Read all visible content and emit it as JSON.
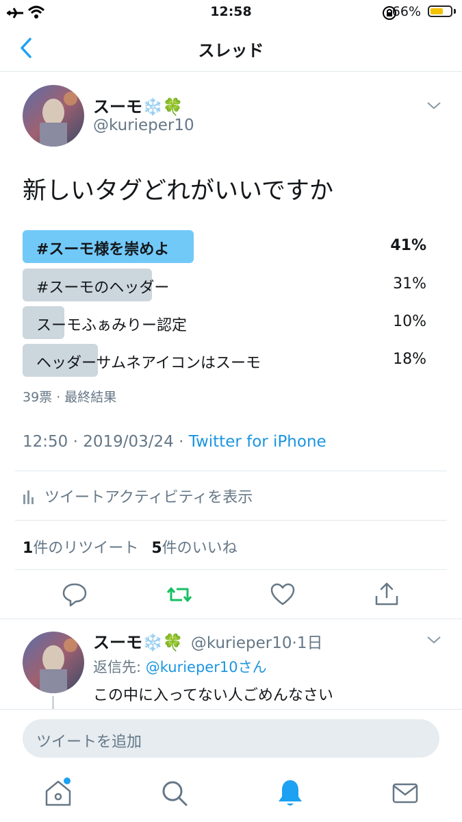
{
  "status": {
    "time": "12:58",
    "battery_pct": "66%",
    "battery_level": 0.66
  },
  "nav": {
    "title": "スレッド"
  },
  "tweet": {
    "name": "スーモ❄️🍀",
    "handle": "@kurieper10",
    "text": "新しいタグどれがいいですか",
    "poll": {
      "options": [
        {
          "label": "#スーモ様を崇めよ",
          "pct": "41%",
          "value": 0.41
        },
        {
          "label": "#スーモのヘッダー",
          "pct": "31%",
          "value": 0.31
        },
        {
          "label": "スーモふぁみりー認定",
          "pct": "10%",
          "value": 0.1
        },
        {
          "label": "ヘッダーサムネアイコンはスーモ",
          "pct": "18%",
          "value": 0.18
        }
      ],
      "meta": "39票 · 最終結果"
    },
    "timestamp": "12:50 · 2019/03/24 · ",
    "source": "Twitter for iPhone",
    "activity": "ツイートアクティビティを表示",
    "retweet_count": "1",
    "retweet_label": "件のリツイート",
    "like_count": "5",
    "like_label": "件のいいね"
  },
  "reply": {
    "name": "スーモ❄️🍀",
    "handle_time": "@kurieper10·1日",
    "reply_prefix": "返信先: ",
    "reply_to": "@kurieper10さん",
    "text": "この中に入ってない人ごめんなさい"
  },
  "compose": {
    "placeholder": "ツイートを追加"
  },
  "colors": {
    "accent": "#1da1f2",
    "retweet_active": "#17bf63",
    "poll_winner": "#71c9f8",
    "poll_bar": "#ccd6dd"
  },
  "icons": [
    "airplane-icon",
    "wifi-icon",
    "lock-rotation-icon",
    "back-chevron-icon",
    "chevron-down-icon",
    "stats-icon",
    "reply-icon",
    "retweet-icon",
    "like-icon",
    "share-icon",
    "home-icon",
    "search-icon",
    "notifications-icon",
    "messages-icon"
  ]
}
